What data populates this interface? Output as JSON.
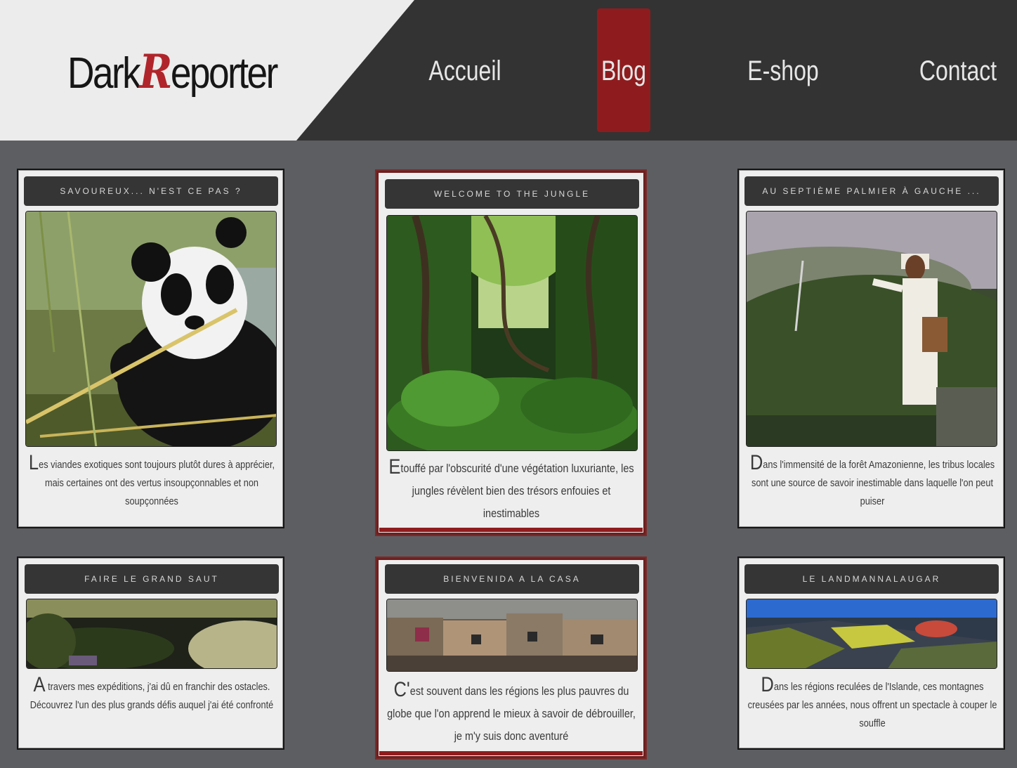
{
  "header": {
    "logo": {
      "part1": "Dark",
      "part2": "R",
      "part3": "eporter"
    },
    "nav": [
      {
        "label": "Accueil",
        "active": false
      },
      {
        "label": "Blog",
        "active": true
      },
      {
        "label": "E-shop",
        "active": false
      },
      {
        "label": "Contact",
        "active": false
      }
    ]
  },
  "colors": {
    "accent": "#8e1c1e",
    "header_bg": "#333333",
    "page_bg": "#5d5e62",
    "card_bg": "#eeeeee"
  },
  "cards": [
    {
      "title": "Savoureux... n'est ce pas ?",
      "image": "panda-eating-bamboo",
      "dropcap": "L",
      "text": "es viandes exotiques sont toujours plutôt dures à apprécier, mais certaines ont des vertus insoupçonnables et non soupçonnées",
      "featured": false
    },
    {
      "title": "Welcome to the jungle",
      "image": "jungle-vegetation",
      "dropcap": "E",
      "text": "touffé par l'obscurité d'une végétation luxuriante, les jungles révèlent bien des trésors enfouies et inestimables",
      "featured": true
    },
    {
      "title": "Au septième palmier à gauche ...",
      "image": "indigenous-man-forest",
      "dropcap": "D",
      "text": "ans l'immensité de la forêt Amazonienne, les tribus locales sont une source de savoir inestimable dans laquelle l'on peut puiser",
      "featured": false
    },
    {
      "title": "Faire le grand saut",
      "image": "grassy-cliff",
      "dropcap": "A",
      "text": " travers mes expéditions, j'ai dû en franchir des ostacles. Découvrez l'un des plus grands défis auquel j'ai été confronté",
      "featured": false
    },
    {
      "title": "Bienvenida a la casa",
      "image": "favela-houses",
      "dropcap": "C'",
      "text": "est souvent dans les régions les plus pauvres du globe que l'on apprend le mieux à savoir de débrouiller, je m'y suis donc aventuré",
      "featured": true
    },
    {
      "title": "Le Landmannalaugar",
      "image": "iceland-mountains",
      "dropcap": "D",
      "text": "ans les régions reculées de l'Islande, ces montagnes creusées par les années, nous offrent un spectacle à couper le souffle",
      "featured": false
    }
  ]
}
